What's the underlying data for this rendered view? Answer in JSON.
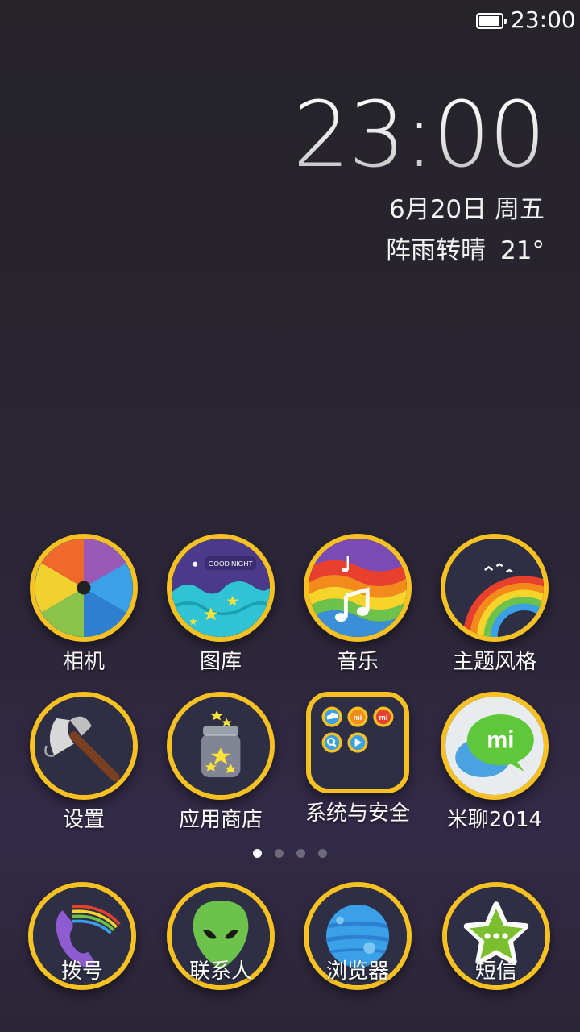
{
  "status_bar": {
    "time": "23:00",
    "battery_level": 0.95
  },
  "clock_widget": {
    "time": "23:00",
    "date": "6月20日 周五",
    "weather": "阵雨转晴",
    "temperature": "21°"
  },
  "apps_row1": [
    {
      "label": "相机",
      "icon": "camera-icon"
    },
    {
      "label": "图库",
      "icon": "gallery-icon",
      "badge_text": "GOOD NIGHT"
    },
    {
      "label": "音乐",
      "icon": "music-icon"
    },
    {
      "label": "主题风格",
      "icon": "theme-icon"
    }
  ],
  "apps_row2": [
    {
      "label": "设置",
      "icon": "axe-icon"
    },
    {
      "label": "应用商店",
      "icon": "star-jar-icon"
    },
    {
      "label": "系统与安全",
      "icon": "folder-icon"
    },
    {
      "label": "米聊2014",
      "icon": "mi-chat-icon",
      "badge_text": "mi"
    }
  ],
  "folder_mini_icons": [
    {
      "name": "cloud-icon",
      "color": "#3aa0e8"
    },
    {
      "name": "mi-orange-icon",
      "color": "#f28a1c",
      "text": "mi"
    },
    {
      "name": "mi-red-icon",
      "color": "#e8402c",
      "text": "mi"
    },
    {
      "name": "search-icon",
      "color": "#3aa0e8"
    },
    {
      "name": "play-icon",
      "color": "#3aa0e8"
    }
  ],
  "page_indicator": {
    "pages": 4,
    "active": 0
  },
  "dock": [
    {
      "label": "拨号",
      "icon": "phone-icon"
    },
    {
      "label": "联系人",
      "icon": "alien-icon"
    },
    {
      "label": "浏览器",
      "icon": "planet-icon"
    },
    {
      "label": "短信",
      "icon": "star-message-icon"
    }
  ],
  "colors": {
    "ring": "#f7c221",
    "background": "#282530"
  }
}
